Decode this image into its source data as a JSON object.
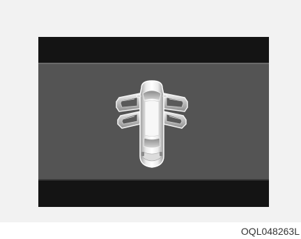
{
  "figure": {
    "code": "OQL048263L"
  },
  "display": {
    "icon": "car-doors-open-icon",
    "doors_open": [
      "front-left",
      "rear-left",
      "front-right",
      "rear-right"
    ]
  },
  "colors": {
    "screen_bar": "#141414",
    "screen_main": "#545454",
    "frame_background": "#f2f2f2"
  }
}
